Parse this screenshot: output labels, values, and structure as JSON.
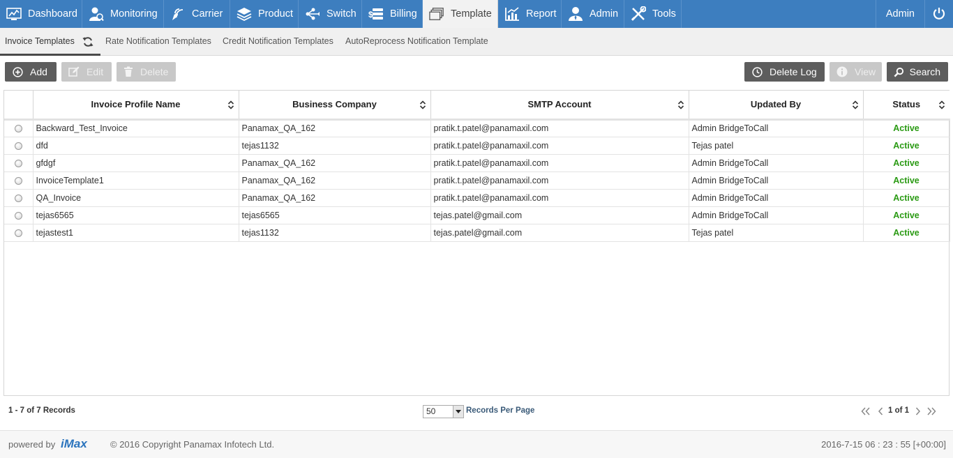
{
  "nav": {
    "items": [
      {
        "label": "Dashboard",
        "icon": "dashboard-icon"
      },
      {
        "label": "Monitoring",
        "icon": "monitoring-icon"
      },
      {
        "label": "Carrier",
        "icon": "carrier-icon"
      },
      {
        "label": "Product",
        "icon": "product-icon"
      },
      {
        "label": "Switch",
        "icon": "switch-icon"
      },
      {
        "label": "Billing",
        "icon": "billing-icon"
      },
      {
        "label": "Template",
        "icon": "template-icon",
        "active": true
      },
      {
        "label": "Report",
        "icon": "report-icon"
      },
      {
        "label": "Admin",
        "icon": "admin-icon"
      },
      {
        "label": "Tools",
        "icon": "tools-icon"
      }
    ],
    "user": "Admin",
    "power_icon": "power-icon"
  },
  "subtabs": [
    {
      "label": "Invoice Templates",
      "active": true
    },
    {
      "label": "Rate Notification Templates"
    },
    {
      "label": "Credit Notification Templates"
    },
    {
      "label": "AutoReprocess Notification Template"
    }
  ],
  "toolbar": {
    "add": "Add",
    "edit": "Edit",
    "delete": "Delete",
    "delete_log": "Delete Log",
    "view": "View",
    "search": "Search"
  },
  "table": {
    "columns": [
      "Invoice Profile Name",
      "Business Company",
      "SMTP Account",
      "Updated By",
      "Status"
    ],
    "rows": [
      [
        "Backward_Test_Invoice",
        "Panamax_QA_162",
        "pratik.t.patel@panamaxil.com",
        "Admin BridgeToCall",
        "Active"
      ],
      [
        "dfd",
        "tejas1132",
        "pratik.t.patel@panamaxil.com",
        "Tejas patel",
        "Active"
      ],
      [
        "gfdgf",
        "Panamax_QA_162",
        "pratik.t.patel@panamaxil.com",
        "Admin BridgeToCall",
        "Active"
      ],
      [
        "InvoiceTemplate1",
        "Panamax_QA_162",
        "pratik.t.patel@panamaxil.com",
        "Admin BridgeToCall",
        "Active"
      ],
      [
        "QA_Invoice",
        "Panamax_QA_162",
        "pratik.t.patel@panamaxil.com",
        "Admin BridgeToCall",
        "Active"
      ],
      [
        "tejas6565",
        "tejas6565",
        "tejas.patel@gmail.com",
        "Admin BridgeToCall",
        "Active"
      ],
      [
        "tejastest1",
        "tejas1132",
        "tejas.patel@gmail.com",
        "Tejas patel",
        "Active"
      ]
    ]
  },
  "pager": {
    "records": "1 - 7 of 7 Records",
    "per_page_value": "50",
    "per_page_label": "Records Per Page",
    "page_text": "1 of 1"
  },
  "footer": {
    "powered": "powered by",
    "logo": "iMax",
    "copyright": "© 2016 Copyright Panamax Infotech Ltd.",
    "clock": "2016-7-15 06 : 23 : 55 [+00:00]"
  },
  "colors": {
    "nav_bg": "#3d7ebf",
    "status_active": "#2a9a13",
    "button_dark": "#5d5d5d",
    "button_disabled": "#c8c8c8"
  }
}
